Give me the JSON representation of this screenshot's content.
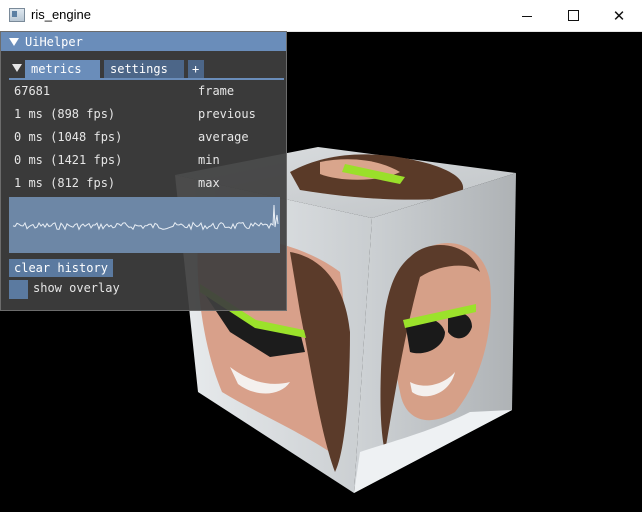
{
  "window": {
    "title": "ris_engine"
  },
  "panel": {
    "title": "UiHelper",
    "tabs": [
      {
        "label": "metrics",
        "active": true
      },
      {
        "label": "settings",
        "active": false
      },
      {
        "label": "+",
        "active": false
      }
    ],
    "metrics": [
      {
        "value": "67681",
        "label": "frame"
      },
      {
        "value": "1 ms (898 fps)",
        "label": "previous"
      },
      {
        "value": "0 ms (1048 fps)",
        "label": "average"
      },
      {
        "value": "0 ms (1421 fps)",
        "label": "min"
      },
      {
        "value": "1 ms (812 fps)",
        "label": "max"
      }
    ],
    "clear_history_label": "clear history",
    "show_overlay_label": "show overlay",
    "show_overlay_checked": false
  },
  "colors": {
    "accent": "#6a8dba",
    "panel_bg": "#3e3e3e",
    "plot_bg": "#6d87a6"
  }
}
